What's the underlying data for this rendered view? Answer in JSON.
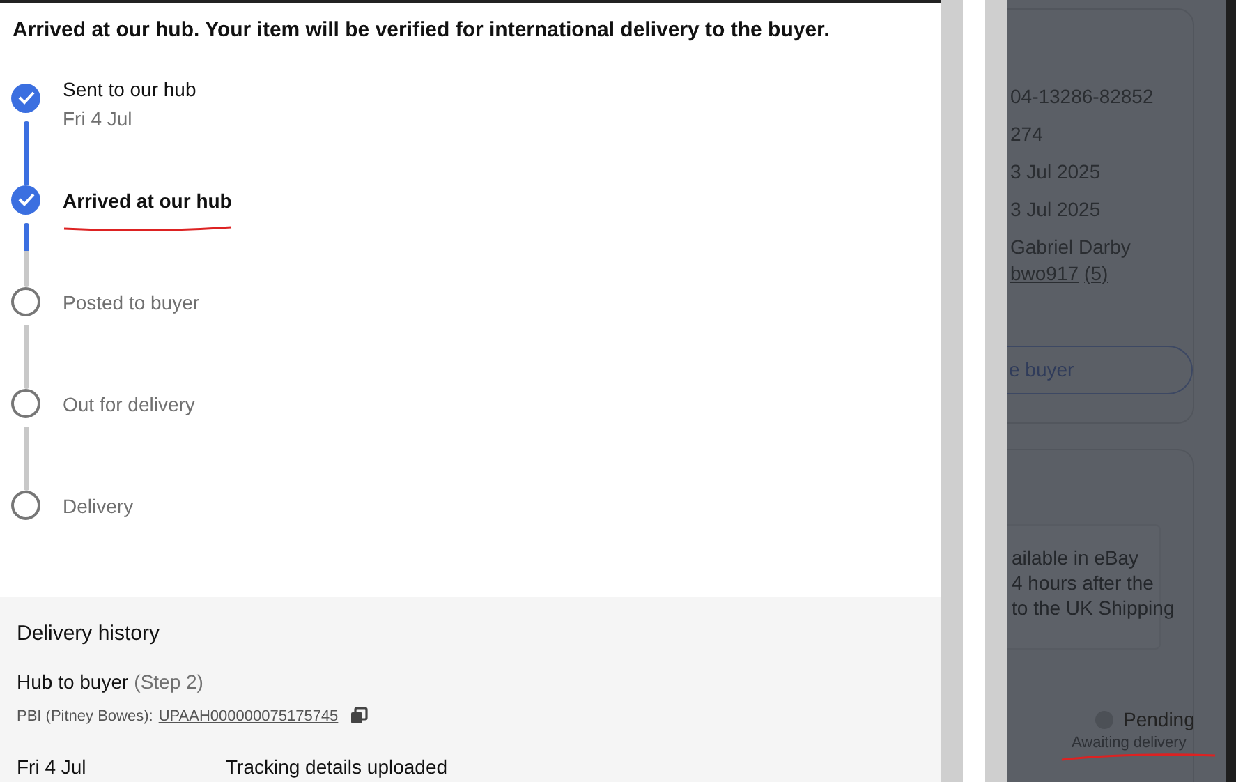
{
  "heading": "Arrived at our hub. Your item will be verified for international delivery to the buyer.",
  "steps": [
    {
      "label": "Sent to our hub",
      "date": "Fri 4 Jul",
      "done": true,
      "current": false,
      "level": 1
    },
    {
      "label": "Arrived at our hub",
      "done": true,
      "current": true,
      "level": 0.45
    },
    {
      "label": "Posted to buyer",
      "done": false,
      "current": false,
      "level": 0
    },
    {
      "label": "Out for delivery",
      "done": false,
      "current": false,
      "level": 0
    },
    {
      "label": "Delivery",
      "done": false,
      "current": false
    }
  ],
  "delivery_history": {
    "title": "Delivery history",
    "leg": "Hub to buyer",
    "leg_step": "(Step 2)",
    "carrier": "PBI (Pitney Bowes):",
    "tracking_number": "UPAAH000000075175745",
    "events": [
      {
        "date": "Fri 4 Jul",
        "description": "Tracking details uploaded"
      }
    ]
  },
  "background_panel": {
    "details": [
      "04-13286-82852",
      "274",
      "3 Jul 2025",
      "3 Jul 2025",
      "Gabriel Darby"
    ],
    "buyer_id": "bwo917",
    "feedback": "(5)",
    "button": "e buyer",
    "info_lines": [
      "ailable in eBay",
      "4 hours after the",
      "to the UK Shipping"
    ],
    "status": "Pending",
    "status_note": "Awaiting delivery"
  }
}
